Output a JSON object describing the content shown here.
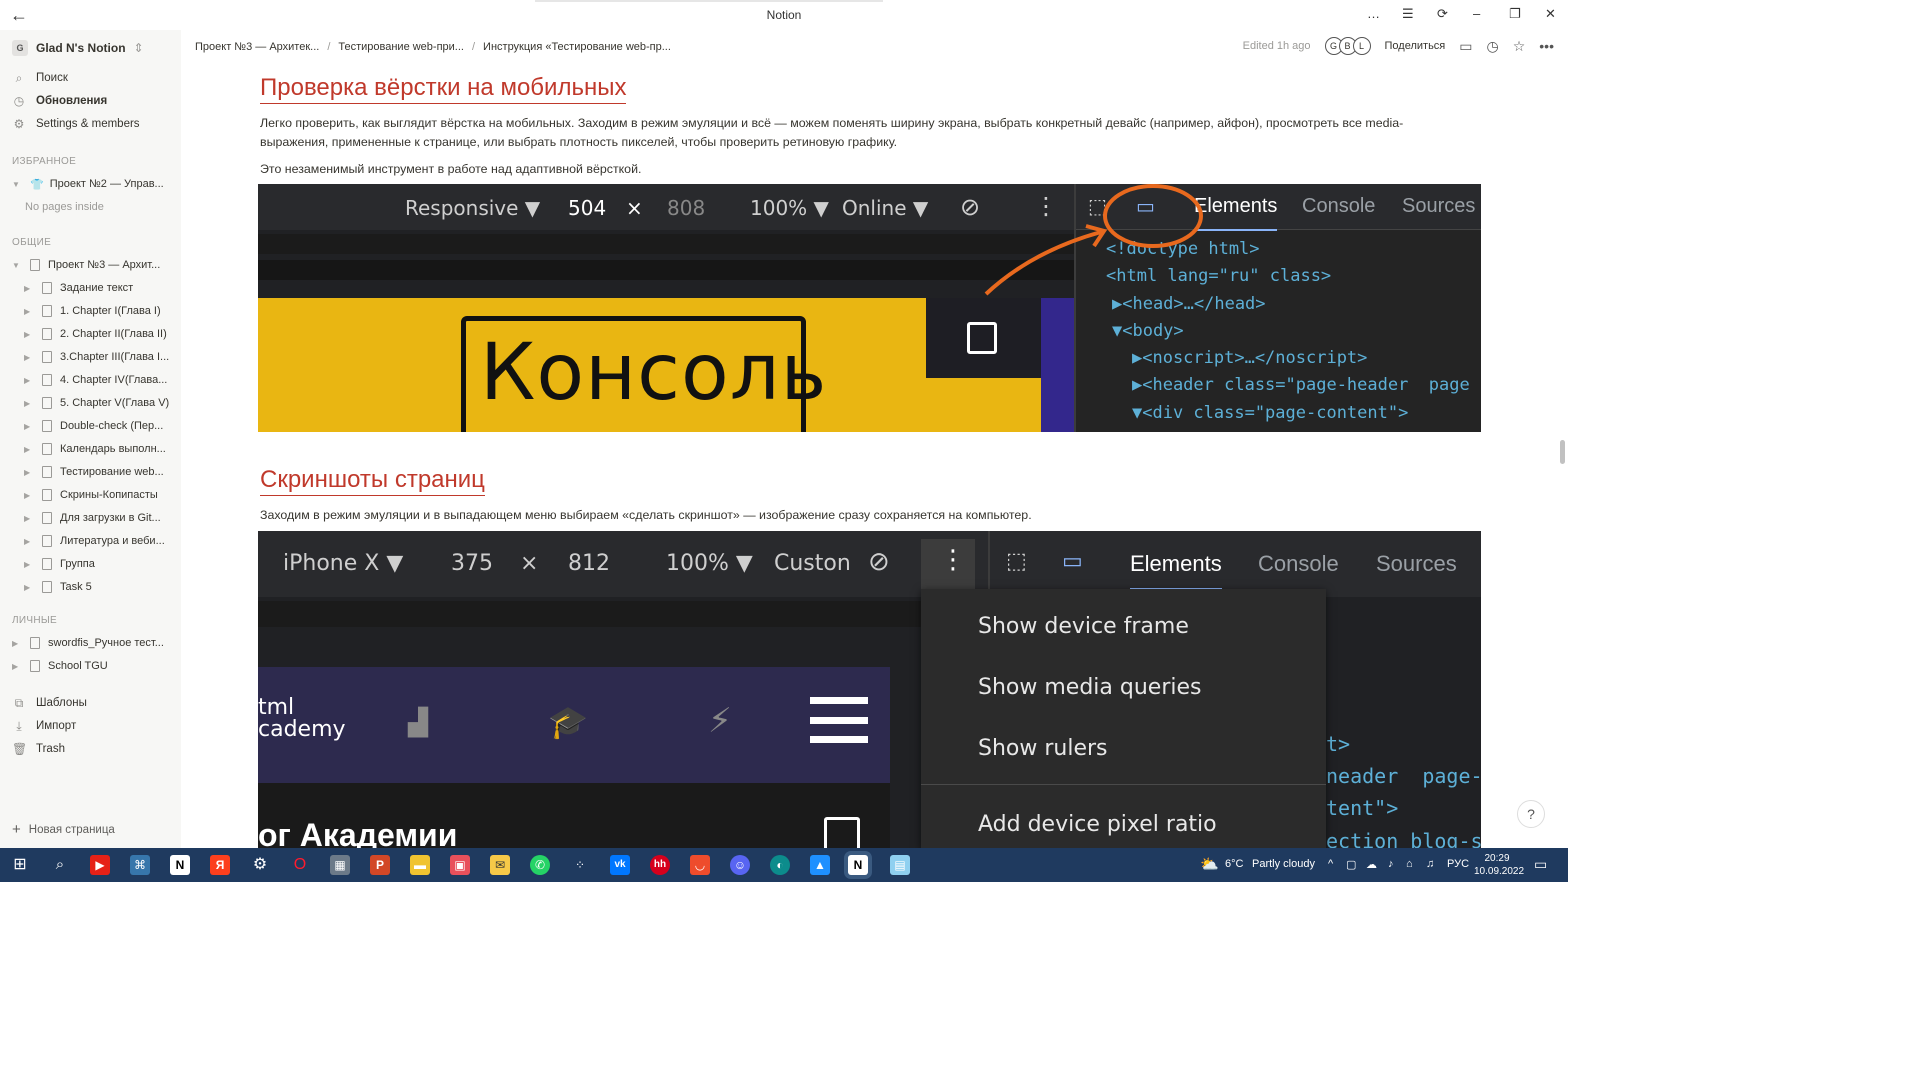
{
  "window": {
    "title": "Notion"
  },
  "sidebar": {
    "workspace_badge": "G",
    "workspace_name": "Glad N's Notion",
    "nav": [
      {
        "label": "Поиск",
        "icon": "search-icon"
      },
      {
        "label": "Обновления",
        "icon": "clock-icon"
      },
      {
        "label": "Settings & members",
        "icon": "gear-icon"
      }
    ],
    "favorites_header": "ИЗБРАННОЕ",
    "favorites": [
      {
        "label": "Проект №2 — Управ...",
        "icon": "shirt-icon"
      }
    ],
    "no_pages": "No pages inside",
    "shared_header": "ОБЩИЕ",
    "shared_root": "Проект №3 — Архит...",
    "shared_children": [
      "Задание текст",
      "1. Chapter I(Глава I)",
      "2. Chapter II(Глава II)",
      "3.Chapter III(Глава I...",
      "4. Chapter IV(Глава...",
      "5. Chapter V(Глава V)",
      "Double-check (Пер...",
      "Календарь выполн...",
      "Тестирование web...",
      "Скрины-Копипасты",
      "Для загрузки в Git...",
      "Литература и веби...",
      "Группа",
      "Task 5"
    ],
    "private_header": "ЛИЧНЫЕ",
    "private": [
      "swordfis_Ручное тест...",
      "School TGU"
    ],
    "bottom": [
      {
        "label": "Шаблоны",
        "icon": "templates-icon"
      },
      {
        "label": "Импорт",
        "icon": "import-icon"
      },
      {
        "label": "Trash",
        "icon": "trash-icon"
      }
    ],
    "new_page": "Новая страница"
  },
  "topbar": {
    "breadcrumbs": [
      "Проект №3 — Архитек...",
      "Тестирование web-при...",
      "Инструкция «Тестирование web-пр..."
    ],
    "edited": "Edited 1h ago",
    "avatars": [
      "G",
      "B",
      "L"
    ],
    "share": "Поделиться"
  },
  "page": {
    "section1": {
      "heading": "Проверка вёрстки на мобильных",
      "para1": "Легко проверить, как выглядит вёрстка на мобильных. Заходим в режим эмуляции и всё — можем поменять ширину экрана, выбрать конкретный девайс (например, айфон), просмотреть все media-",
      "para1b": "выражения, примененные к странице, или выбрать плотность пикселей, чтобы проверить ретиновую графику.",
      "para2": "Это незаменимый инструмент в работе над адаптивной вёрсткой."
    },
    "section2": {
      "heading": "Скриншоты страниц",
      "para1": "Заходим в режим эмуляции и в выпадающем меню выбираем «сделать скриншот» — изображение сразу сохраняется на компьютер."
    }
  },
  "screenshot1": {
    "device": "Responsive ▼",
    "width": "504",
    "times": "×",
    "height": "808",
    "zoom": "100% ▼",
    "network": "Online ▼",
    "tabs": [
      "Elements",
      "Console",
      "Sources"
    ],
    "code": [
      "<!doctype html>",
      "<html lang=\"ru\" class>",
      "▶<head>…</head>",
      "▼<body>",
      "▶<noscript>…</noscript>",
      "▶<header class=\"page-header  page",
      "▼<div class=\"page-content\">"
    ],
    "banner_word": "Консоль",
    "annotation_color": "#e8691e"
  },
  "screenshot2": {
    "device": "iPhone X ▼",
    "width": "375",
    "times": "×",
    "height": "812",
    "zoom": "100% ▼",
    "network": "Custon",
    "tabs": [
      "Elements",
      "Console",
      "Sources"
    ],
    "menu": [
      "Show device frame",
      "Show media queries",
      "Show rulers",
      "Add device pixel ratio"
    ],
    "site_logo": "tml\ncademy",
    "site_heading": "ог Академии",
    "code": [
      "t>",
      "neader  page-",
      "tent\">",
      "ection blog-s"
    ]
  },
  "taskbar": {
    "weather_temp": "6°C",
    "weather_text": "Partly cloudy",
    "lang": "РУС",
    "time": "20:29",
    "date": "10.09.2022"
  },
  "colors": {
    "heading": "#c0392b",
    "sidebar_bg": "#f7f7f5",
    "taskbar_bg": "#1f3a5f"
  }
}
